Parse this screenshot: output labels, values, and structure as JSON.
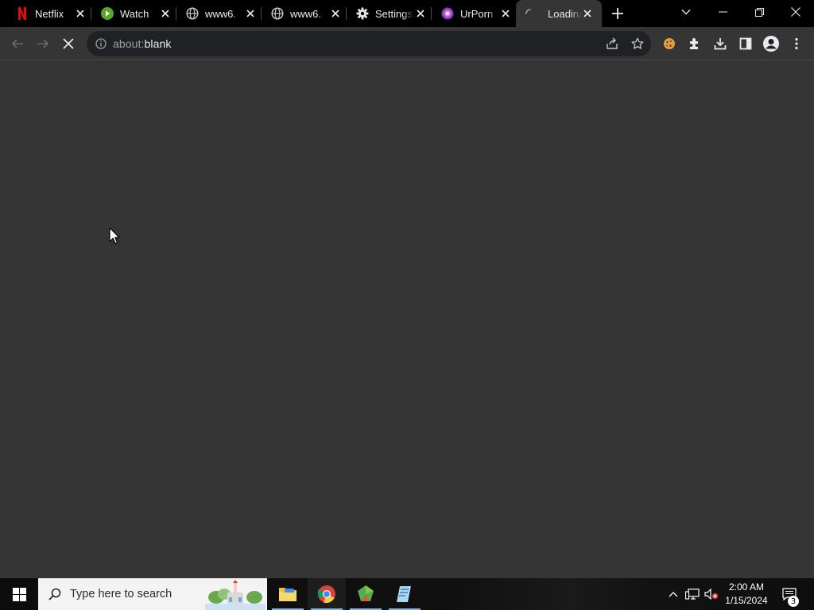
{
  "tabs": [
    {
      "title": "Netflix",
      "icon": "netflix-icon"
    },
    {
      "title": "Watch",
      "icon": "play-icon"
    },
    {
      "title": "www6.",
      "icon": "globe-icon"
    },
    {
      "title": "www6.",
      "icon": "globe-icon"
    },
    {
      "title": "Settings",
      "icon": "gear-icon"
    },
    {
      "title": "UrPorn",
      "icon": "site-icon"
    },
    {
      "title": "Loading",
      "icon": "loading-spinner-icon",
      "active": true
    }
  ],
  "address_bar": {
    "scheme": "about:",
    "path": "blank"
  },
  "taskbar": {
    "search_placeholder": "Type here to search",
    "time": "2:00 AM",
    "date": "1/15/2024",
    "notification_count": "3"
  },
  "colors": {
    "browser_frame": "#000000",
    "toolbar": "#353535",
    "omnibox": "#202124",
    "page_background": "#353535",
    "netflix_red": "#e50914",
    "taskbar_search": "#f3f3f3",
    "taskbar_indicator": "#7fb2e5"
  }
}
